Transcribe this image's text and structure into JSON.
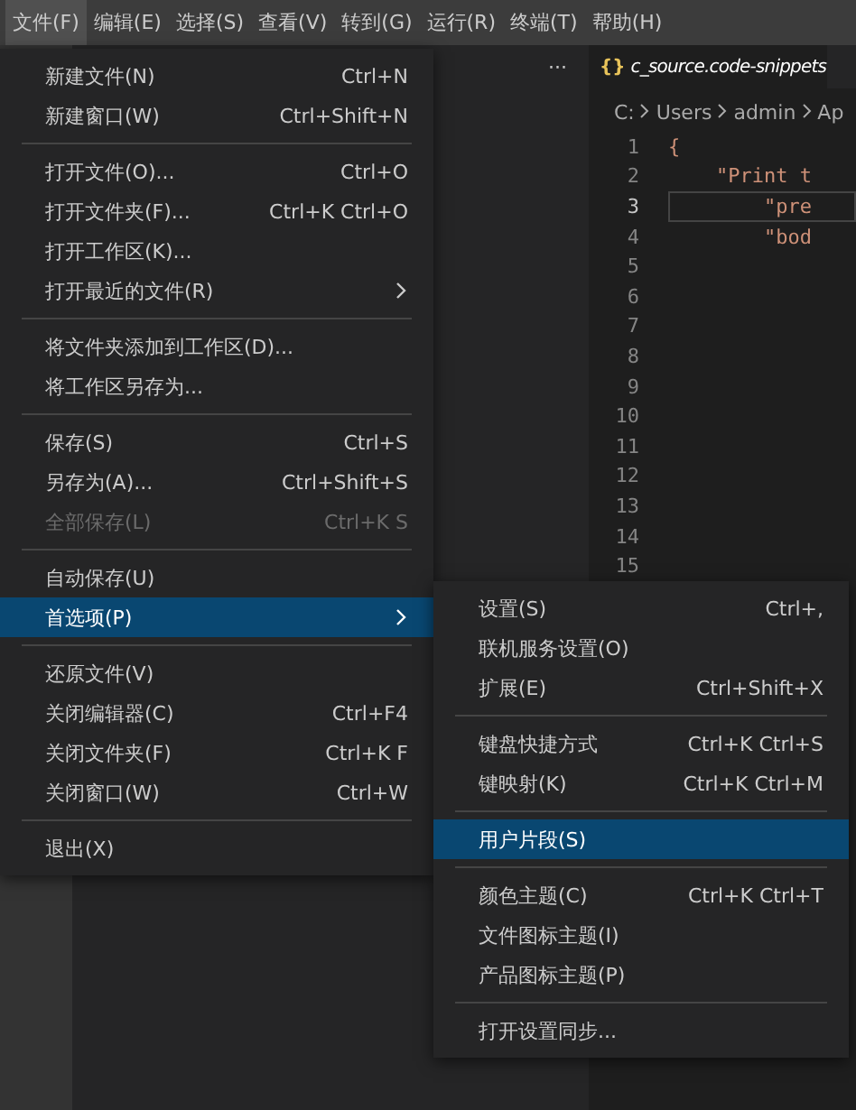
{
  "menubar": [
    {
      "label": "文件(F)",
      "selected": true
    },
    {
      "label": "编辑(E)",
      "selected": false
    },
    {
      "label": "选择(S)",
      "selected": false
    },
    {
      "label": "查看(V)",
      "selected": false
    },
    {
      "label": "转到(G)",
      "selected": false
    },
    {
      "label": "运行(R)",
      "selected": false
    },
    {
      "label": "终端(T)",
      "selected": false
    },
    {
      "label": "帮助(H)",
      "selected": false
    }
  ],
  "sidebar": {
    "more": "···"
  },
  "editor": {
    "tab": {
      "icon": "{}",
      "title": "c_source.code-snippets"
    },
    "breadcrumb": [
      "C:",
      "Users",
      "admin",
      "Ap"
    ],
    "lines": [
      {
        "number": "1",
        "code": "{",
        "current": false
      },
      {
        "number": "2",
        "code": "    \"Print t",
        "current": false
      },
      {
        "number": "3",
        "code": "        \"pre",
        "current": true
      },
      {
        "number": "4",
        "code": "        \"bod",
        "current": false
      },
      {
        "number": "5",
        "current": false
      },
      {
        "number": "6",
        "current": false
      },
      {
        "number": "7",
        "current": false
      },
      {
        "number": "8",
        "current": false
      },
      {
        "number": "9",
        "current": false
      },
      {
        "number": "10",
        "current": false
      },
      {
        "number": "11",
        "current": false
      },
      {
        "number": "12",
        "current": false
      },
      {
        "number": "13",
        "current": false
      },
      {
        "number": "14",
        "current": false
      },
      {
        "number": "15",
        "current": false
      }
    ]
  },
  "file_menu": [
    [
      {
        "label": "新建文件(N)",
        "shortcut": "Ctrl+N",
        "disabled": false,
        "selected": false,
        "submenu": false
      },
      {
        "label": "新建窗口(W)",
        "shortcut": "Ctrl+Shift+N",
        "disabled": false,
        "selected": false,
        "submenu": false
      }
    ],
    [
      {
        "label": "打开文件(O)...",
        "shortcut": "Ctrl+O",
        "disabled": false,
        "selected": false,
        "submenu": false
      },
      {
        "label": "打开文件夹(F)...",
        "shortcut": "Ctrl+K Ctrl+O",
        "disabled": false,
        "selected": false,
        "submenu": false
      },
      {
        "label": "打开工作区(K)...",
        "disabled": false,
        "selected": false,
        "submenu": false
      },
      {
        "label": "打开最近的文件(R)",
        "disabled": false,
        "selected": false,
        "submenu": true
      }
    ],
    [
      {
        "label": "将文件夹添加到工作区(D)...",
        "disabled": false,
        "selected": false,
        "submenu": false
      },
      {
        "label": "将工作区另存为...",
        "disabled": false,
        "selected": false,
        "submenu": false
      }
    ],
    [
      {
        "label": "保存(S)",
        "shortcut": "Ctrl+S",
        "disabled": false,
        "selected": false,
        "submenu": false
      },
      {
        "label": "另存为(A)...",
        "shortcut": "Ctrl+Shift+S",
        "disabled": false,
        "selected": false,
        "submenu": false
      },
      {
        "label": "全部保存(L)",
        "shortcut": "Ctrl+K S",
        "disabled": true,
        "selected": false,
        "submenu": false
      }
    ],
    [
      {
        "label": "自动保存(U)",
        "disabled": false,
        "selected": false,
        "submenu": false
      },
      {
        "label": "首选项(P)",
        "disabled": false,
        "selected": true,
        "submenu": true
      }
    ],
    [
      {
        "label": "还原文件(V)",
        "disabled": false,
        "selected": false,
        "submenu": false
      },
      {
        "label": "关闭编辑器(C)",
        "shortcut": "Ctrl+F4",
        "disabled": false,
        "selected": false,
        "submenu": false
      },
      {
        "label": "关闭文件夹(F)",
        "shortcut": "Ctrl+K F",
        "disabled": false,
        "selected": false,
        "submenu": false
      },
      {
        "label": "关闭窗口(W)",
        "shortcut": "Ctrl+W",
        "disabled": false,
        "selected": false,
        "submenu": false
      }
    ],
    [
      {
        "label": "退出(X)",
        "disabled": false,
        "selected": false,
        "submenu": false
      }
    ]
  ],
  "preferences_menu": [
    [
      {
        "label": "设置(S)",
        "shortcut": "Ctrl+,",
        "disabled": false,
        "selected": false,
        "submenu": false
      },
      {
        "label": "联机服务设置(O)",
        "disabled": false,
        "selected": false,
        "submenu": false
      },
      {
        "label": "扩展(E)",
        "shortcut": "Ctrl+Shift+X",
        "disabled": false,
        "selected": false,
        "submenu": false
      }
    ],
    [
      {
        "label": "键盘快捷方式",
        "shortcut": "Ctrl+K Ctrl+S",
        "disabled": false,
        "selected": false,
        "submenu": false
      },
      {
        "label": "键映射(K)",
        "shortcut": "Ctrl+K Ctrl+M",
        "disabled": false,
        "selected": false,
        "submenu": false
      }
    ],
    [
      {
        "label": "用户片段(S)",
        "disabled": false,
        "selected": true,
        "submenu": false
      }
    ],
    [
      {
        "label": "颜色主题(C)",
        "shortcut": "Ctrl+K Ctrl+T",
        "disabled": false,
        "selected": false,
        "submenu": false
      },
      {
        "label": "文件图标主题(I)",
        "disabled": false,
        "selected": false,
        "submenu": false
      },
      {
        "label": "产品图标主题(P)",
        "disabled": false,
        "selected": false,
        "submenu": false
      }
    ],
    [
      {
        "label": "打开设置同步...",
        "disabled": false,
        "selected": false,
        "submenu": false
      }
    ]
  ]
}
